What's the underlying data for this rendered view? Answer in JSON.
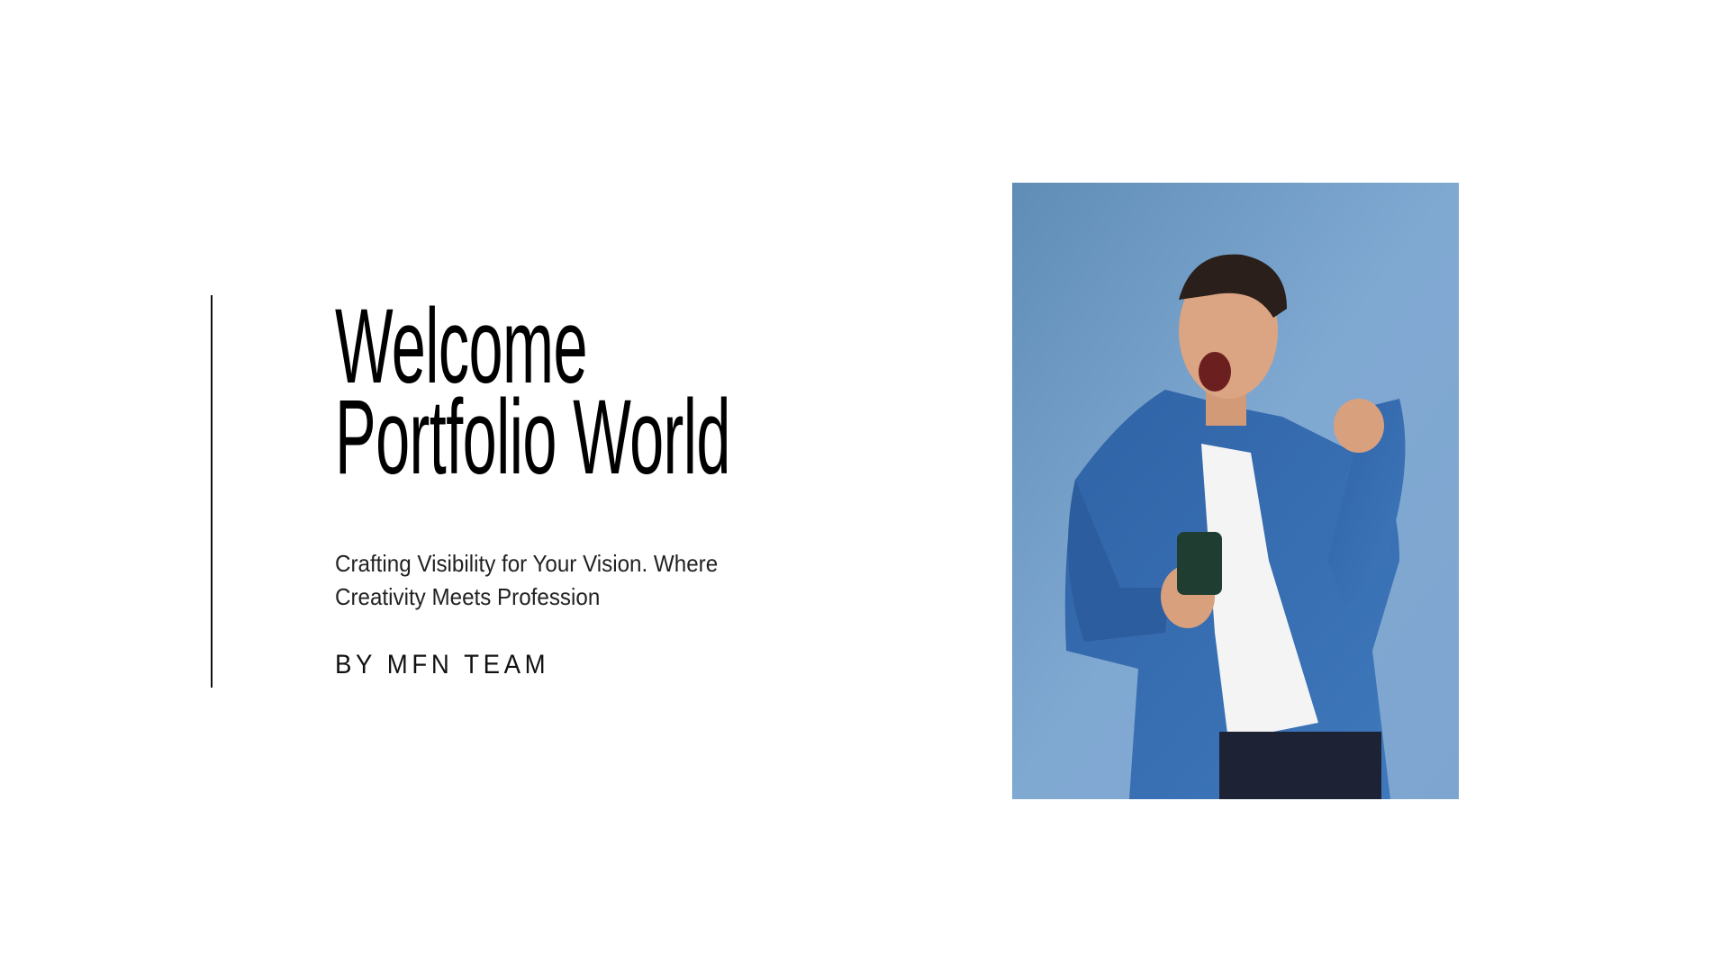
{
  "slide": {
    "title_lines": [
      "Welcome",
      "Portfolio World"
    ],
    "subtitle": "Crafting Visibility for Your Vision. Where Creativity Meets Profession",
    "byline": "BY MFN TEAM"
  },
  "colors": {
    "photo_background": "#7aa3cc",
    "shirt": "#3a6fb0",
    "text": "#000000"
  }
}
